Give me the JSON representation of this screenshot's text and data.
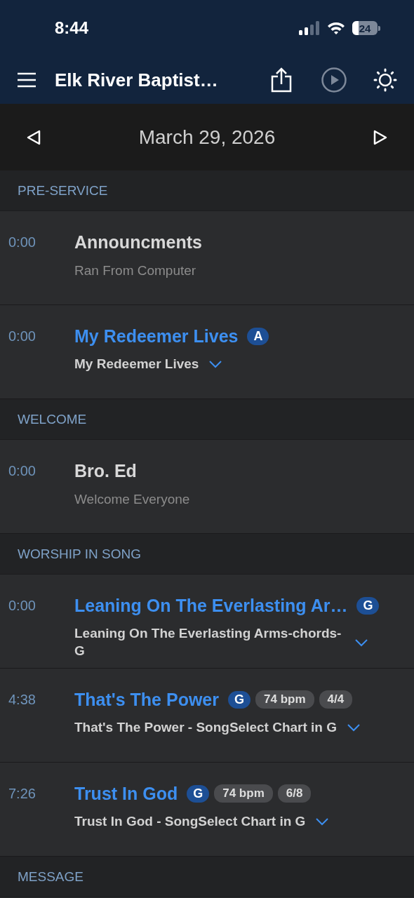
{
  "status_bar": {
    "time": "8:44",
    "battery": "24"
  },
  "toolbar": {
    "title": "Elk River Baptist…"
  },
  "date_bar": {
    "date": "March 29, 2026"
  },
  "sections": [
    {
      "title": "PRE-SERVICE",
      "items": [
        {
          "kind": "item",
          "time": "0:00",
          "title": "Announcments",
          "description": "Ran From Computer"
        },
        {
          "kind": "song",
          "time": "0:00",
          "title": "My Redeemer Lives",
          "key": "A",
          "arrangement": "My Redeemer Lives"
        }
      ]
    },
    {
      "title": "WELCOME",
      "items": [
        {
          "kind": "item",
          "time": "0:00",
          "title": "Bro. Ed",
          "description": "Welcome Everyone"
        }
      ]
    },
    {
      "title": "WORSHIP IN SONG",
      "items": [
        {
          "kind": "song",
          "time": "0:00",
          "title": "Leaning On The Everlasting Ar…",
          "key": "G",
          "arrangement": "Leaning On The Everlasting Arms-chords-G"
        },
        {
          "kind": "song",
          "time": "4:38",
          "title": "That's The Power",
          "key": "G",
          "bpm": "74 bpm",
          "meter": "4/4",
          "arrangement": "That's The Power - SongSelect Chart in G"
        },
        {
          "kind": "song",
          "time": "7:26",
          "title": "Trust In God",
          "key": "G",
          "bpm": "74 bpm",
          "meter": "6/8",
          "arrangement": "Trust In God - SongSelect Chart in G"
        }
      ]
    },
    {
      "title": "MESSAGE"
    }
  ]
}
